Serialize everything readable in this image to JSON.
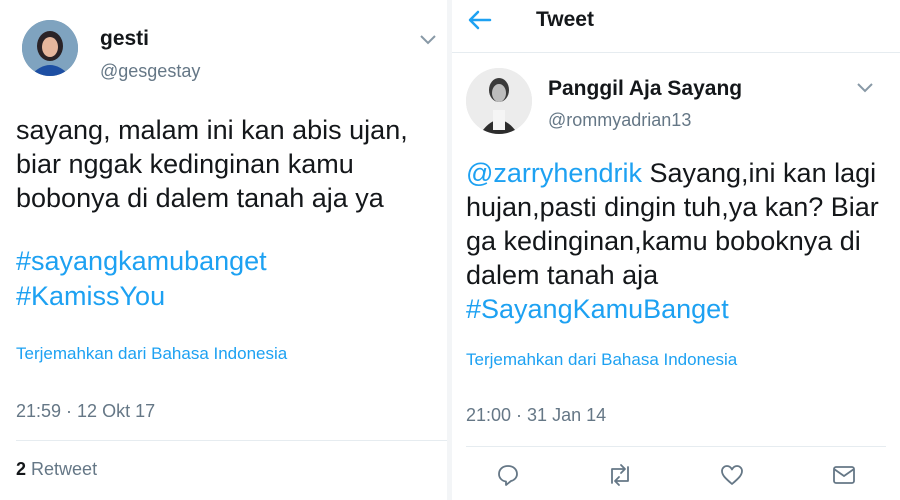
{
  "left_tweet": {
    "display_name": "gesti",
    "handle": "@gesgestay",
    "lines": [
      "sayang, malam ini kan abis ujan,",
      "biar nggak kedinginan kamu",
      "bobonya di dalem tanah aja ya"
    ],
    "hashtags": [
      "#sayangkamubanget",
      "#KamissYou"
    ],
    "translate_label": "Terjemahkan dari Bahasa Indonesia",
    "timestamp": "21:59 · 12 Okt 17",
    "retweet_count": "2",
    "retweet_label": "Retweet"
  },
  "right_header": {
    "title": "Tweet"
  },
  "right_tweet": {
    "display_name": "Panggil Aja Sayang",
    "handle": "@rommyadrian13",
    "mention": "@zarryhendrik",
    "line1_rest": " Sayang,ini kan lagi",
    "lines": [
      "hujan,pasti dingin tuh,ya kan? Biar",
      "ga kedinginan,kamu boboknya di",
      "dalem tanah aja"
    ],
    "hashtag": "#SayangKamuBanget",
    "translate_label": "Terjemahkan dari Bahasa Indonesia",
    "timestamp": "21:00 · 31 Jan 14"
  },
  "colors": {
    "link": "#1da1f2",
    "text": "#14171a",
    "muted": "#657786",
    "divider": "#e6ecf0"
  },
  "icons": [
    "back-arrow-icon",
    "chevron-down-icon",
    "reply-icon",
    "retweet-icon",
    "like-icon",
    "message-icon"
  ]
}
